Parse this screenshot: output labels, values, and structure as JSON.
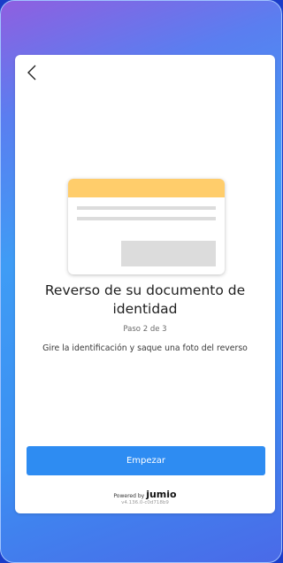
{
  "nav": {
    "back_icon": "chevron-left-icon"
  },
  "illustration": {
    "name": "id-card-back-illustration",
    "accent_color": "#ffcd6b"
  },
  "content": {
    "title": "Reverso de su documento de identidad",
    "step": "Paso 2 de 3",
    "instruction": "Gire la identificación y saque una foto del reverso"
  },
  "actions": {
    "start_label": "Empezar",
    "start_color": "#2e8cf2"
  },
  "footer": {
    "powered_by": "Powered by",
    "brand": "jumio",
    "version": "v4.136.0-c0d718b9"
  }
}
